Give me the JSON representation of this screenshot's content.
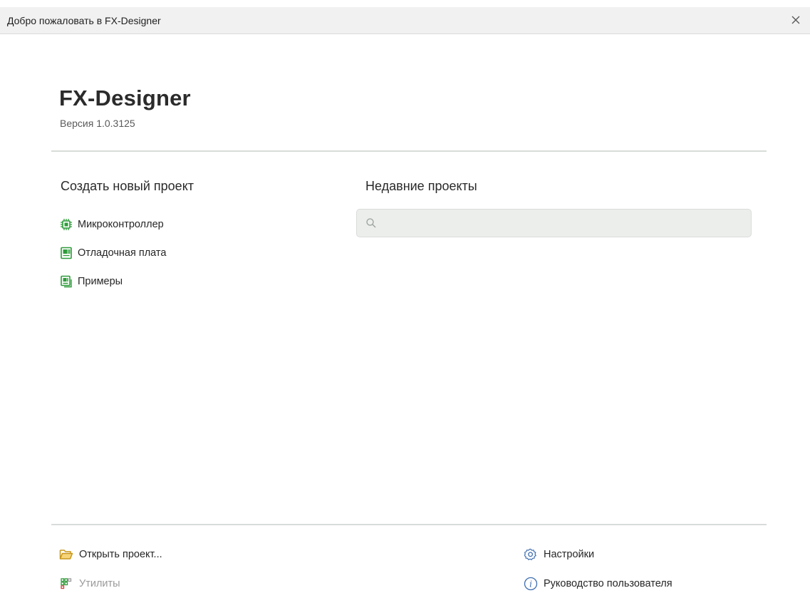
{
  "window": {
    "title": "Добро пожаловать в FX-Designer",
    "close_symbol": "✕"
  },
  "header": {
    "app_name": "FX-Designer",
    "version": "Версия 1.0.3125"
  },
  "create": {
    "title": "Создать новый проект",
    "items": [
      {
        "label": "Микроконтроллер",
        "icon": "chip-icon"
      },
      {
        "label": "Отладочная плата",
        "icon": "board-icon"
      },
      {
        "label": "Примеры",
        "icon": "examples-icon"
      }
    ]
  },
  "recent": {
    "title": "Недавние проекты",
    "search_value": "",
    "search_placeholder": ""
  },
  "footer": {
    "open_project": "Открыть проект...",
    "utilities": "Утилиты",
    "settings": "Настройки",
    "user_manual": "Руководство пользователя"
  },
  "colors": {
    "accent_green": "#2e9b3a",
    "folder_yellow": "#d9a520",
    "disabled_text": "#9a9a9a",
    "settings_blue": "#3f6fb0"
  }
}
